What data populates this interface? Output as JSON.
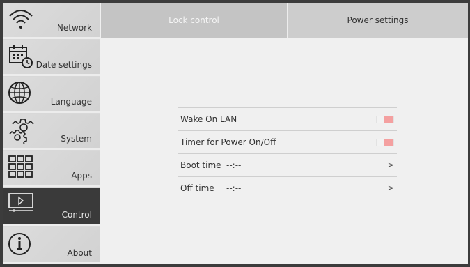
{
  "sidebar": {
    "items": [
      {
        "label": "Network",
        "icon": "wifi-icon"
      },
      {
        "label": "Date settings",
        "icon": "calendar-clock-icon"
      },
      {
        "label": "Language",
        "icon": "globe-icon"
      },
      {
        "label": "System",
        "icon": "gears-icon"
      },
      {
        "label": "Apps",
        "icon": "apps-grid-icon"
      },
      {
        "label": "Control",
        "icon": "display-play-icon",
        "active": true
      },
      {
        "label": "About",
        "icon": "info-icon"
      }
    ]
  },
  "tabs": [
    {
      "label": "Lock control"
    },
    {
      "label": "Power settings",
      "active": true
    }
  ],
  "power": {
    "wake_on_lan": {
      "label": "Wake On LAN",
      "on": false
    },
    "timer": {
      "label": "Timer for Power On/Off",
      "on": false
    },
    "boot_time": {
      "label": "Boot time",
      "value": "--:--",
      "chevron": ">"
    },
    "off_time": {
      "label": "Off time",
      "value": "--:--",
      "chevron": ">"
    }
  },
  "colors": {
    "toggle_knob": "#f4a0a0",
    "active_sidebar": "#3a3a3a"
  }
}
